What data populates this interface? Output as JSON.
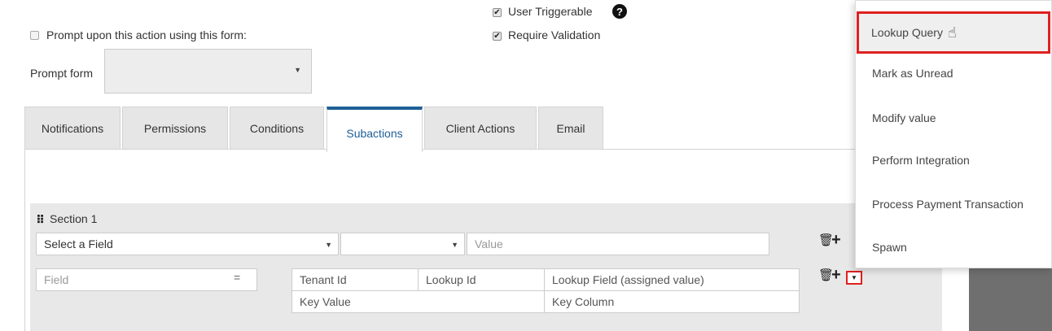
{
  "top_options": {
    "prompt_checkbox_label": "Prompt upon this action using this form:",
    "prompt_form_label": "Prompt form",
    "prompt_form_value": "",
    "user_triggerable_label": "User Triggerable",
    "require_validation_label": "Require Validation"
  },
  "tabs": [
    {
      "label": "Notifications"
    },
    {
      "label": "Permissions"
    },
    {
      "label": "Conditions"
    },
    {
      "label": "Subactions"
    },
    {
      "label": "Client Actions"
    },
    {
      "label": "Email"
    }
  ],
  "section": {
    "title": "Section 1",
    "row1": {
      "field_select": "Select a Field",
      "operator_select": "",
      "value_placeholder": "Value"
    },
    "row2": {
      "field_placeholder": "Field",
      "equals": "=",
      "tenant_id": "Tenant Id",
      "lookup_id": "Lookup Id",
      "lookup_field": "Lookup Field (assigned value)",
      "key_value": "Key Value",
      "key_column": "Key Column"
    }
  },
  "dropdown": {
    "items": [
      {
        "label": "Lookup Query"
      },
      {
        "label": "Mark as Unread"
      },
      {
        "label": "Modify value"
      },
      {
        "label": "Perform Integration"
      },
      {
        "label": "Process Payment Transaction"
      },
      {
        "label": "Spawn"
      }
    ]
  },
  "colors": {
    "active_tab": "#1f5f96",
    "highlight_box": "#e02020",
    "panel_bg": "#e8e8e8"
  }
}
